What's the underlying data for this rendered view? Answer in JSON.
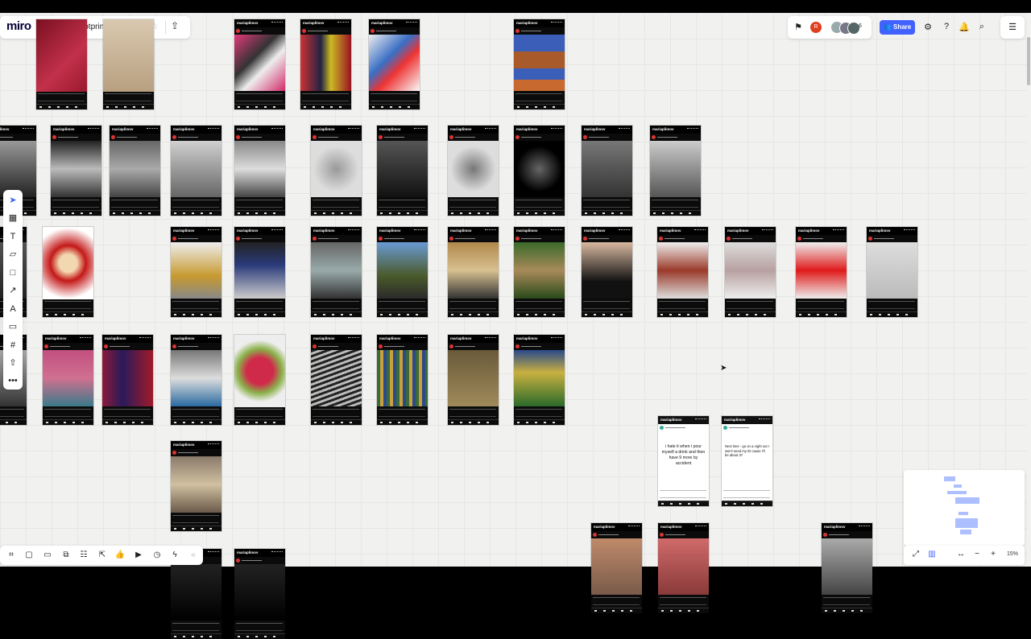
{
  "app": {
    "logo": "miro",
    "board_title": "Digital Footprint Workshop",
    "collaborator_count": "6"
  },
  "topbar": {
    "share_label": "Share",
    "avatar_initial": "R"
  },
  "card_header": "mariaplimov",
  "text_posts": [
    "i hate it when i pour myself a drink and then have 9 more by accident",
    "Next time - go on a night out I won't need my ID cause I'll be about 37"
  ],
  "zoom": {
    "level": "15%"
  },
  "icons": {
    "toolbar": [
      "select-icon",
      "table-icon",
      "text-icon",
      "sticky-note-icon",
      "shape-icon",
      "connector-icon",
      "pen-icon",
      "comment-icon",
      "frame-icon",
      "upload-icon",
      "more-icon"
    ],
    "bottombar": [
      "frames-icon",
      "comments-icon",
      "chat-icon",
      "cards-icon",
      "kanban-icon",
      "share-screen-icon",
      "reaction-icon",
      "video-icon",
      "timer-icon",
      "apps-icon",
      "collapse-icon"
    ]
  },
  "colors": {
    "accent": "#4262ff",
    "board": "#f1f1f0",
    "avatar_red": "#e0401f"
  }
}
